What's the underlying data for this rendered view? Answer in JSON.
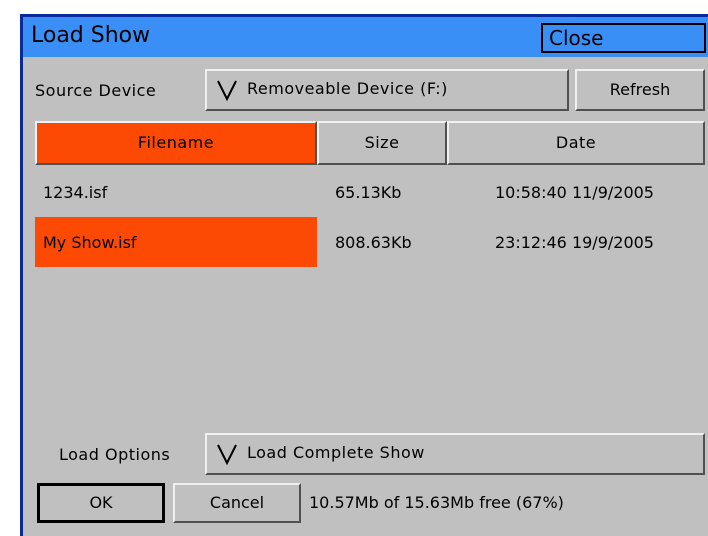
{
  "window": {
    "title": "Load Show",
    "close_label": "Close"
  },
  "source": {
    "label": "Source Device",
    "device": "Removeable Device (F:)",
    "refresh_label": "Refresh"
  },
  "table": {
    "columns": [
      "Filename",
      "Size",
      "Date"
    ],
    "sorted_column": "Filename",
    "rows": [
      {
        "filename": "1234.isf",
        "size": "65.13Kb",
        "date": "10:58:40 11/9/2005",
        "selected": false
      },
      {
        "filename": "My Show.isf",
        "size": "808.63Kb",
        "date": "23:12:46 19/9/2005",
        "selected": true
      }
    ]
  },
  "load_options": {
    "label": "Load Options",
    "value": "Load Complete Show"
  },
  "footer": {
    "ok_label": "OK",
    "cancel_label": "Cancel",
    "free_space": "10.57Mb of 15.63Mb free (67%)"
  },
  "colors": {
    "title_bar": "#3a8ff7",
    "accent": "#fc4a05",
    "panel": "#c0c0c0"
  }
}
